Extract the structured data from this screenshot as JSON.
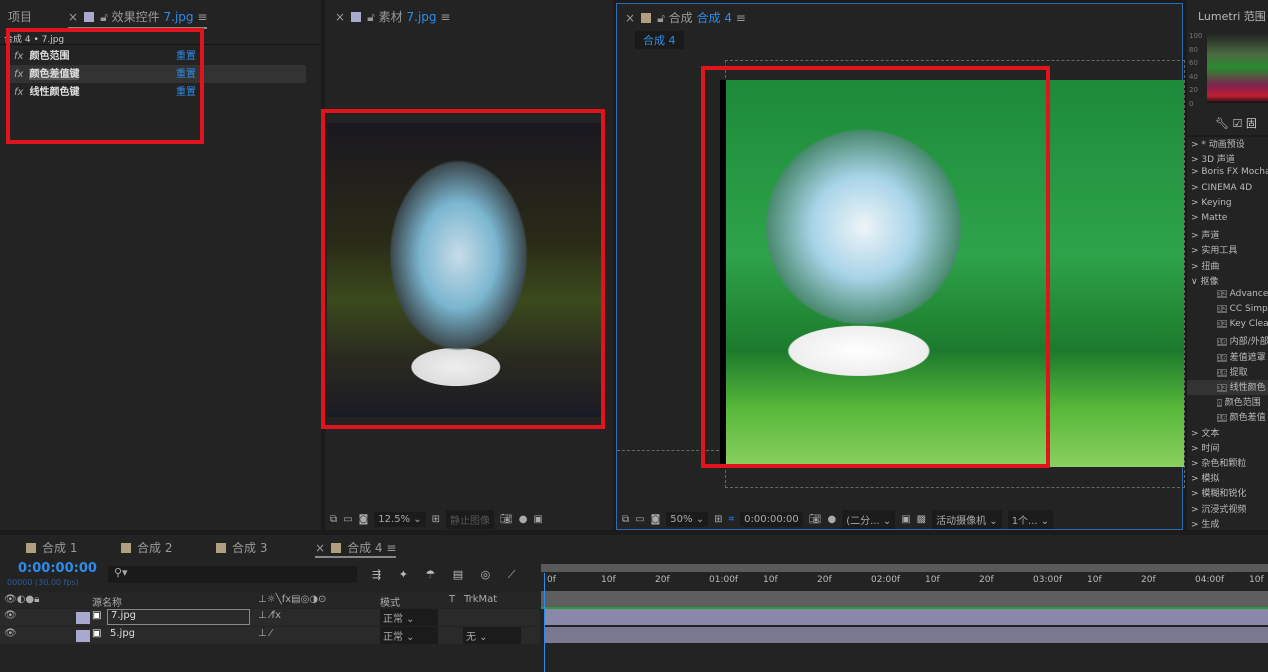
{
  "project_panel": {
    "tab": "项目"
  },
  "effect_controls": {
    "tab_prefix": "效果控件",
    "tab_file": "7.jpg",
    "breadcrumb": "合成 4 • 7.jpg",
    "effects": [
      {
        "name": "颜色范围",
        "reset": "重置"
      },
      {
        "name": "颜色差值键",
        "reset": "重置"
      },
      {
        "name": "线性颜色键",
        "reset": "重置"
      }
    ]
  },
  "footage_panel": {
    "tab_prefix": "素材",
    "tab_file": "7.jpg",
    "zoom": "12.5%",
    "still_label": "静止图像"
  },
  "comp_panel": {
    "tab_prefix": "合成",
    "tab_comp": "合成 4",
    "breadcrumb": "合成 4",
    "zoom": "50%",
    "timecode": "0:00:00:00",
    "resolution": "(二分...",
    "camera": "活动摄像机",
    "views": "1个..."
  },
  "lumetri": {
    "title": "Lumetri 范围",
    "scale": [
      "100",
      "80",
      "60",
      "40",
      "20",
      "0"
    ]
  },
  "effects_list": {
    "items": [
      "> * 动画预设",
      "> 3D 声道",
      "> Boris FX Mocha",
      "> CINEMA 4D",
      "> Keying",
      "> Matte",
      "> 声道",
      "> 实用工具",
      "> 扭曲",
      "∨ 抠像"
    ],
    "keying": [
      {
        "bit": "32",
        "name": "Advanced"
      },
      {
        "bit": "32",
        "name": "CC Simple"
      },
      {
        "bit": "32",
        "name": "Key Clean"
      },
      {
        "bit": "16",
        "name": "内部/外部"
      },
      {
        "bit": "16",
        "name": "差值遮罩"
      },
      {
        "bit": "16",
        "name": "提取"
      },
      {
        "bit": "32",
        "name": "线性颜色"
      },
      {
        "bit": "8",
        "name": "颜色范围"
      },
      {
        "bit": "16",
        "name": "颜色差值"
      }
    ],
    "after": [
      "> 文本",
      "> 时间",
      "> 杂色和颗粒",
      "> 模拟",
      "> 模糊和锐化",
      "> 沉浸式视频",
      "> 生成"
    ]
  },
  "timeline": {
    "tabs": [
      "合成 1",
      "合成 2",
      "合成 3",
      "合成 4"
    ],
    "timecode": "0:00:00:00",
    "fps": "00000 (30.00 fps)",
    "headers": {
      "source": "源名称",
      "mode": "模式",
      "t": "T",
      "trkmat": "TrkMat"
    },
    "layers": [
      {
        "name": "7.jpg",
        "mode": "正常",
        "trkmat": ""
      },
      {
        "name": "5.jpg",
        "mode": "正常",
        "trkmat": "无"
      }
    ],
    "ruler": [
      "0f",
      "10f",
      "20f",
      "01:00f",
      "10f",
      "20f",
      "02:00f",
      "10f",
      "20f",
      "03:00f",
      "10f",
      "20f",
      "04:00f",
      "10f"
    ]
  },
  "colors": {
    "accent": "#2d8ceb",
    "highlight": "#e0141c",
    "label_footage": "#a8a8d0",
    "label_comp": "#b0a080"
  }
}
